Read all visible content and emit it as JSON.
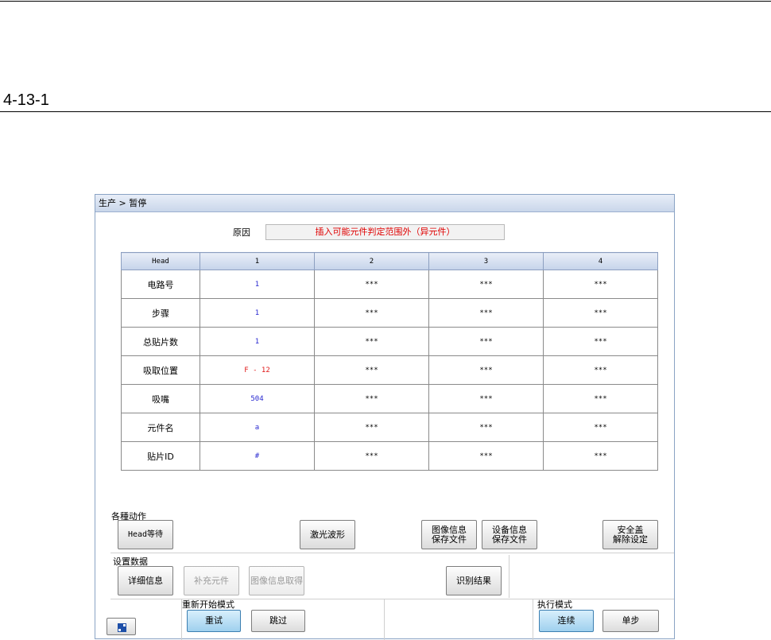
{
  "document": {
    "section_number": "4-13-1"
  },
  "window": {
    "breadcrumb": "生产 > 暂停",
    "reason": {
      "label": "原因",
      "value": "插入可能元件判定范围外（异元件）"
    },
    "table": {
      "columns": [
        "Head",
        "1",
        "2",
        "3",
        "4"
      ],
      "rows": [
        {
          "label": "电路号",
          "values": [
            "1",
            "***",
            "***",
            "***"
          ]
        },
        {
          "label": "步骤",
          "values": [
            "1",
            "***",
            "***",
            "***"
          ]
        },
        {
          "label": "总贴片数",
          "values": [
            "1",
            "***",
            "***",
            "***"
          ]
        },
        {
          "label": "吸取位置",
          "values": [
            "F - 12",
            "***",
            "***",
            "***"
          ]
        },
        {
          "label": "吸嘴",
          "values": [
            "504",
            "***",
            "***",
            "***"
          ]
        },
        {
          "label": "元件名",
          "values": [
            "a",
            "***",
            "***",
            "***"
          ]
        },
        {
          "label": "贴片ID",
          "values": [
            "#",
            "***",
            "***",
            "***"
          ]
        }
      ]
    },
    "actions": {
      "label": "各種动作",
      "head_wait": "Head等待",
      "laser": "激光波形",
      "image_save_1": "图像信息",
      "image_save_2": "保存文件",
      "device_save_1": "设备信息",
      "device_save_2": "保存文件",
      "safety_1": "安全盖",
      "safety_2": "解除设定"
    },
    "settings": {
      "label": "设置数据",
      "detail": "详细信息",
      "supplement": "补充元件",
      "image_get": "图像信息取得",
      "recognize": "识别结果"
    },
    "restart": {
      "label": "重新开始模式",
      "retry": "重试",
      "skip": "跳过"
    },
    "exec": {
      "label": "执行模式",
      "continuous": "连续",
      "step": "单步"
    },
    "icons": {
      "corner": "window-tile-icon"
    }
  }
}
